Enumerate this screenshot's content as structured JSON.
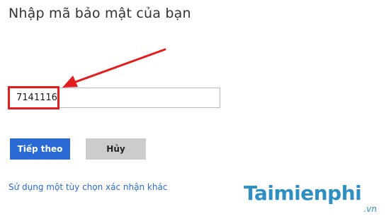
{
  "page": {
    "title": "Nhập mã bảo mật của bạn"
  },
  "form": {
    "code_value": "7141116"
  },
  "buttons": {
    "next_label": "Tiếp theo",
    "cancel_label": "Hủy"
  },
  "links": {
    "alternate_verification": "Sử dụng một tùy chọn xác nhận khác"
  },
  "annotation": {
    "color": "#e31d1d"
  },
  "watermark": {
    "brand": "Taimienphi",
    "tld": ".vn"
  },
  "colors": {
    "primary_button": "#2a6ad5",
    "secondary_button": "#cccccc",
    "link": "#2a6ad5",
    "watermark": "#2d8fc4"
  }
}
